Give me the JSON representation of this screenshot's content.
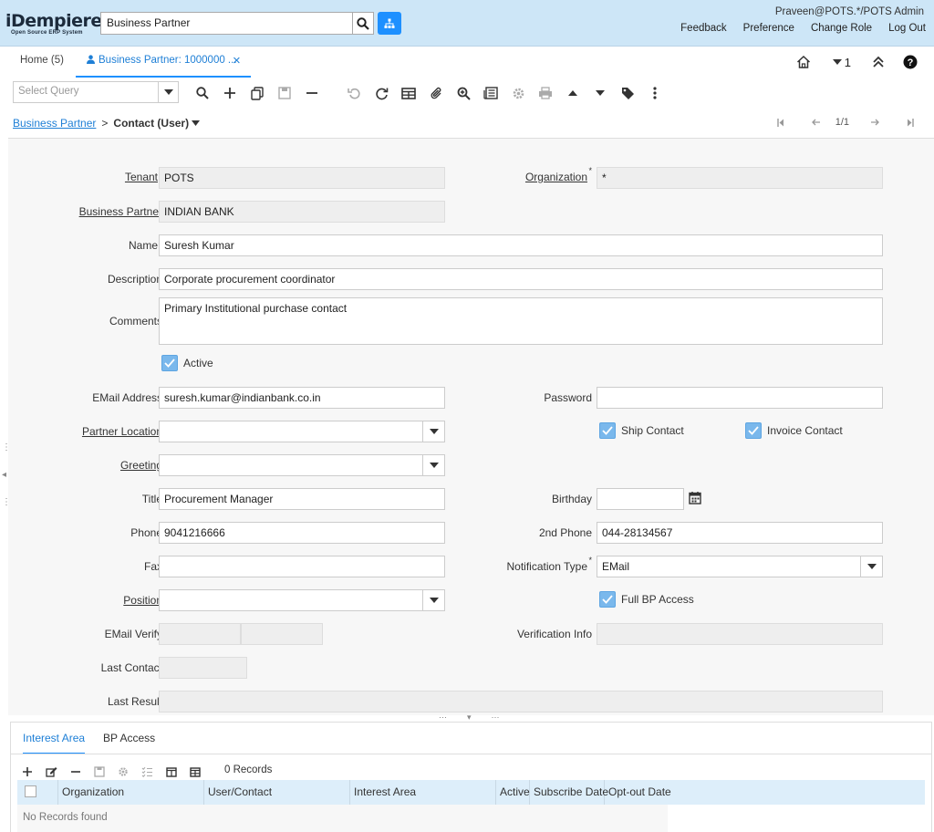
{
  "app": {
    "logo_main": "iDempiere",
    "logo_sub": "Open Source ERP System",
    "search_value": "Business Partner",
    "user": "Praveen@POTS.*/POTS Admin",
    "links": [
      "Feedback",
      "Preference",
      "Change Role",
      "Log Out"
    ]
  },
  "tabs": {
    "home": "Home (5)",
    "active": "Business Partner: 1000000 ...",
    "window_count": "1"
  },
  "toolbar": {
    "query_placeholder": "Select Query"
  },
  "breadcrumb": {
    "parent": "Business Partner",
    "separator": ">",
    "current": "Contact (User)"
  },
  "record_nav": {
    "position": "1/1"
  },
  "form": {
    "labels": {
      "tenant": "Tenant",
      "organization": "Organization",
      "business_partner": "Business Partner",
      "name": "Name",
      "description": "Description",
      "comments": "Comments",
      "active": "Active",
      "email": "EMail Address",
      "password": "Password",
      "partner_location": "Partner Location",
      "ship_contact": "Ship Contact",
      "invoice_contact": "Invoice Contact",
      "greeting": "Greeting",
      "title": "Title",
      "birthday": "Birthday",
      "phone": "Phone",
      "phone2": "2nd Phone",
      "fax": "Fax",
      "notification_type": "Notification Type",
      "position": "Position",
      "full_bp_access": "Full BP Access",
      "email_verify": "EMail Verify",
      "verification_info": "Verification Info",
      "last_contact": "Last Contact",
      "last_result": "Last Result"
    },
    "values": {
      "tenant": "POTS",
      "organization": "*",
      "business_partner": "INDIAN BANK",
      "name": "Suresh Kumar",
      "description": "Corporate procurement coordinator",
      "comments": "Primary Institutional purchase contact",
      "email": "suresh.kumar@indianbank.co.in",
      "password": "",
      "partner_location": "",
      "greeting": "",
      "title": "Procurement Manager",
      "birthday": "",
      "phone": "9041216666",
      "phone2": "044-28134567",
      "fax": "",
      "notification_type": "EMail",
      "position": ""
    },
    "checks": {
      "active": true,
      "ship_contact": true,
      "invoice_contact": true,
      "full_bp_access": true
    }
  },
  "detail": {
    "tabs": [
      "Interest Area",
      "BP Access"
    ],
    "records": "0 Records",
    "columns": [
      "Organization",
      "User/Contact",
      "Interest Area",
      "Active",
      "Subscribe Date",
      "Opt-out Date"
    ],
    "empty_text": "No Records found"
  },
  "colors": {
    "header_bg": "#cde6f7",
    "accent": "#1e90ff",
    "link": "#1e7fd6"
  }
}
